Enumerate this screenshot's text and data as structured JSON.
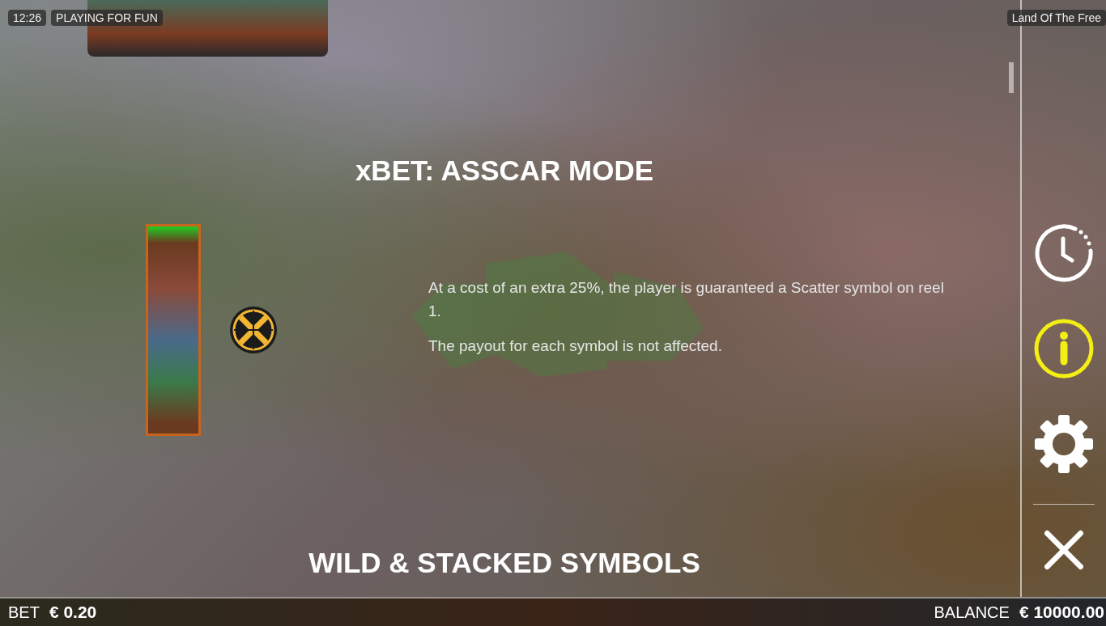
{
  "status": {
    "time": "12:26",
    "mode": "PLAYING FOR FUN"
  },
  "game_title": "Land Of The Free",
  "sections": [
    {
      "heading": "xBET: ASSCAR MODE",
      "paragraphs": [
        "At a cost of an extra 25%, the player is guaranteed a Scatter symbol on reel 1.",
        "The payout for each symbol is not affected."
      ]
    },
    {
      "heading": "WILD & STACKED SYMBOLS"
    }
  ],
  "sidebar": {
    "buttons": [
      {
        "kind": "history",
        "selected": false
      },
      {
        "kind": "info",
        "selected": true
      },
      {
        "kind": "settings",
        "selected": false
      },
      {
        "kind": "close",
        "selected": false
      }
    ]
  },
  "footer": {
    "bet_label": "BET",
    "bet_value": "€ 0.20",
    "balance_label": "BALANCE",
    "balance_value": "€ 10000.00"
  }
}
